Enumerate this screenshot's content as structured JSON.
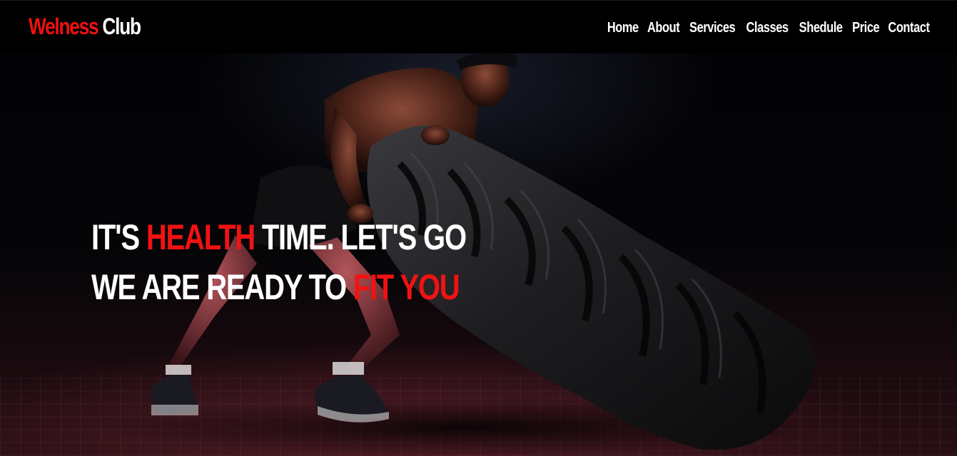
{
  "brand": {
    "name_part1": "Welness",
    "name_part2": "Club",
    "accent_color": "#f01010"
  },
  "nav": {
    "items": [
      {
        "label": "Home"
      },
      {
        "label": "About"
      },
      {
        "label": "Services"
      },
      {
        "label": "Classes"
      },
      {
        "label": "Shedule"
      },
      {
        "label": "Price"
      },
      {
        "label": "Contact"
      }
    ]
  },
  "hero": {
    "line1": {
      "before": "IT'S ",
      "highlight": "HEALTH",
      "after": " TIME. LET'S GO"
    },
    "line2": {
      "before": "WE ARE READY TO ",
      "highlight": "FIT YOU"
    },
    "image_subject": "athlete flipping a large tire"
  }
}
